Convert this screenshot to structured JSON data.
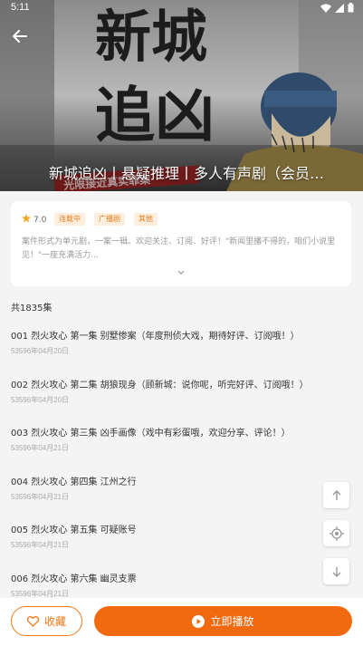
{
  "status_bar": {
    "time": "5:11"
  },
  "header": {
    "title": "新城追凶丨悬疑推理丨多人有声剧（会员…",
    "cover_text_top": "新城",
    "cover_text_bottom": "追凶",
    "cover_banner": "光限接近真实罪案"
  },
  "info": {
    "rating": "7.0",
    "tags": [
      "连载中",
      "广播剧",
      "其他"
    ],
    "description": "案件形式为单元剧，一案一辑。欢迎关注、订阅、好评！\"新闻里播不得的，咱们小说里见！\"一座充满活力..."
  },
  "episode_count": "共1835集",
  "episodes": [
    {
      "title": "001 烈火攻心 第一集 别墅惨案（年度刑侦大戏，期待好评、订阅哦！）",
      "date": "53596年04月20日"
    },
    {
      "title": "002 烈火攻心 第二集 胡狼现身（顾新城：说你呢，听完好评、订阅哦！）",
      "date": "53596年04月20日"
    },
    {
      "title": "003 烈火攻心 第三集 凶手画像（戏中有彩蛋哦，欢迎分享、评论！）",
      "date": "53596年04月21日"
    },
    {
      "title": "004 烈火攻心 第四集 江州之行",
      "date": "53596年04月21日"
    },
    {
      "title": "005 烈火攻心 第五集 可疑账号",
      "date": "53596年04月21日"
    },
    {
      "title": "006 烈火攻心 第六集 幽灵支票",
      "date": "53596年04月21日"
    }
  ],
  "bottom": {
    "favorite_label": "收藏",
    "play_label": "立即播放"
  },
  "colors": {
    "accent": "#f26a10",
    "star": "#f5a623"
  }
}
